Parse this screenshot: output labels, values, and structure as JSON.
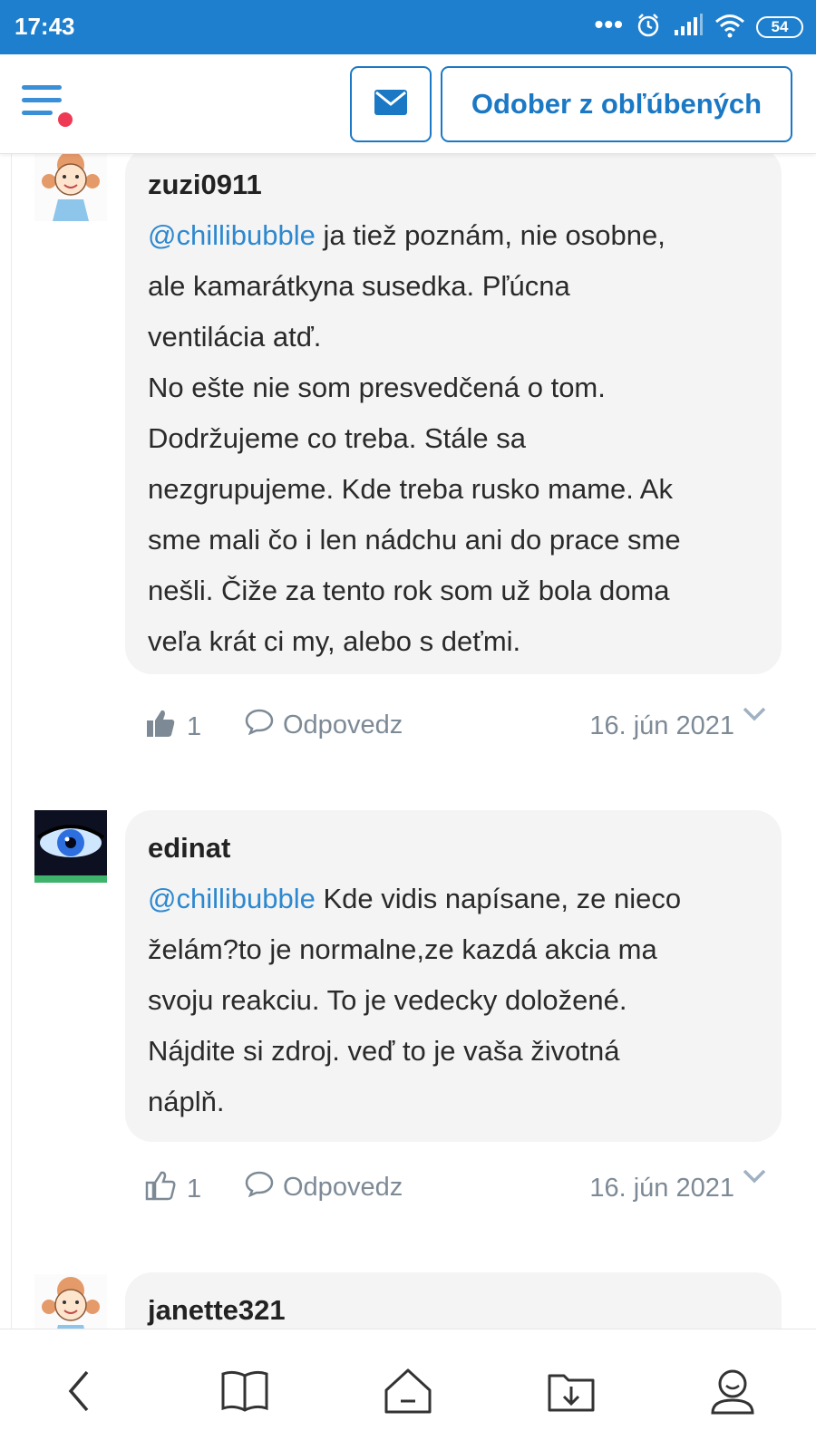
{
  "status_bar": {
    "time": "17:43",
    "battery": "54",
    "icons": [
      "more-dots-icon",
      "alarm-icon",
      "signal-icon",
      "wifi-icon",
      "battery-icon"
    ]
  },
  "header": {
    "menu_icon": "hamburger-menu-icon",
    "mail_icon": "envelope-icon",
    "favorite_button_label": "Odober z obľúbených",
    "accent_color": "#1b78c4",
    "notification_dot_color": "#ee3a55"
  },
  "comments": [
    {
      "author": "zuzi0911",
      "mention": "@chillibubble",
      "text_lines": [
        " ja tiež poznám, nie osobne,",
        "ale kamarátkyna susedka. Pľúcna",
        "ventilácia atď.",
        "No ešte nie som presvedčená o tom.",
        "Dodržujeme co treba. Stále sa",
        "nezgrupujeme. Kde treba rusko mame. Ak",
        "sme mali čo i len nádchu ani do prace sme",
        "nešli. Čiže za tento rok som už bola doma",
        "veľa krát ci my, alebo s deťmi."
      ],
      "likes": "1",
      "liked": true,
      "reply_label": "Odpovedz",
      "date": "16. jún 2021"
    },
    {
      "author": "edinat",
      "mention": "@chillibubble",
      "text_lines": [
        " Kde vidis napísane, ze nieco",
        "želám?to je normalne,ze kazdá akcia ma",
        "svoju reakciu. To je vedecky doložené.",
        "Nájdite si zdroj. veď to je vaša životná",
        "náplň."
      ],
      "likes": "1",
      "liked": false,
      "reply_label": "Odpovedz",
      "date": "16. jún 2021"
    },
    {
      "author": "janette321"
    }
  ],
  "bottom_nav": [
    "back-icon",
    "book-icon",
    "home-icon",
    "download-folder-icon",
    "profile-icon"
  ]
}
